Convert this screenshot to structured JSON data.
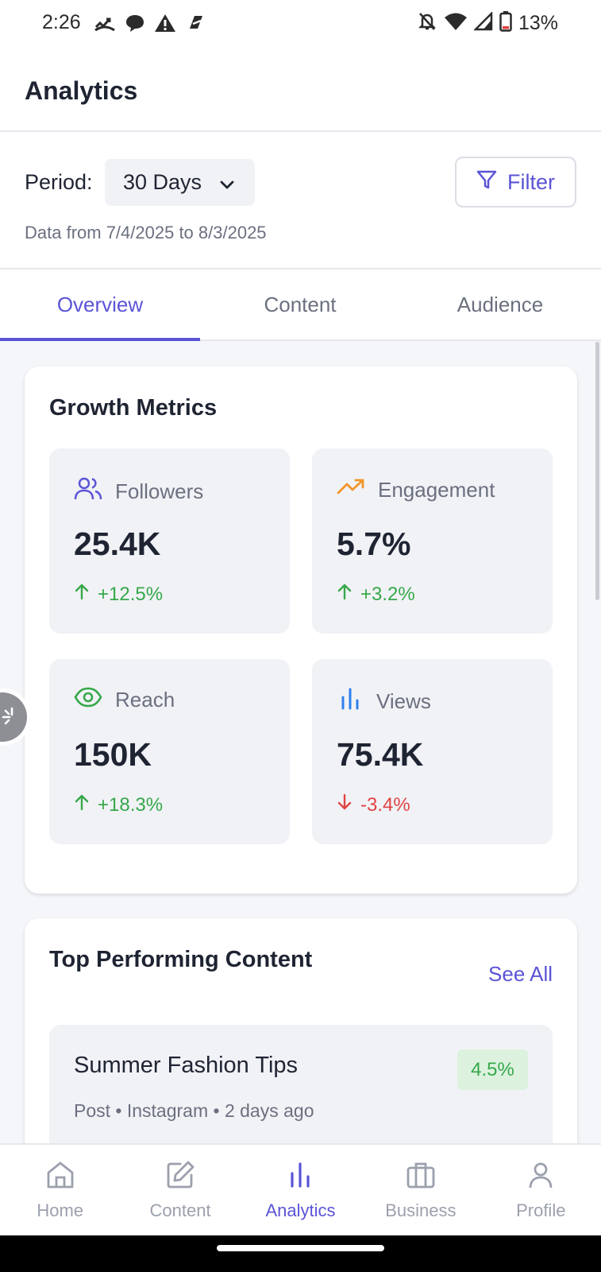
{
  "status_bar": {
    "time": "2:26",
    "battery": "13%"
  },
  "header": {
    "title": "Analytics"
  },
  "period": {
    "label": "Period:",
    "selected": "30 Days",
    "filter_label": "Filter",
    "date_range": "Data from 7/4/2025 to 8/3/2025"
  },
  "tabs": [
    {
      "label": "Overview",
      "active": true
    },
    {
      "label": "Content",
      "active": false
    },
    {
      "label": "Audience",
      "active": false
    }
  ],
  "growth": {
    "title": "Growth Metrics",
    "metrics": [
      {
        "label": "Followers",
        "value": "25.4K",
        "change": "+12.5%",
        "trend": "up",
        "icon": "users-icon",
        "color": "#5b54d6"
      },
      {
        "label": "Engagement",
        "value": "5.7%",
        "change": "+3.2%",
        "trend": "up",
        "icon": "trending-up-icon",
        "color": "#f2962b"
      },
      {
        "label": "Reach",
        "value": "150K",
        "change": "+18.3%",
        "trend": "up",
        "icon": "eye-icon",
        "color": "#36a84a"
      },
      {
        "label": "Views",
        "value": "75.4K",
        "change": "-3.4%",
        "trend": "down",
        "icon": "bar-chart-icon",
        "color": "#2f80ed"
      }
    ]
  },
  "top_content": {
    "title": "Top Performing Content",
    "see_all": "See All",
    "items": [
      {
        "title": "Summer Fashion Tips",
        "meta": "Post • Instagram • 2 days ago",
        "rate": "4.5%"
      }
    ]
  },
  "bottom_nav": [
    {
      "label": "Home",
      "icon": "home-icon",
      "active": false
    },
    {
      "label": "Content",
      "icon": "edit-icon",
      "active": false
    },
    {
      "label": "Analytics",
      "icon": "bar-chart-icon",
      "active": true
    },
    {
      "label": "Business",
      "icon": "briefcase-icon",
      "active": false
    },
    {
      "label": "Profile",
      "icon": "user-icon",
      "active": false
    }
  ],
  "colors": {
    "accent": "#5b54d6",
    "positive": "#36a84a",
    "negative": "#e04343"
  }
}
